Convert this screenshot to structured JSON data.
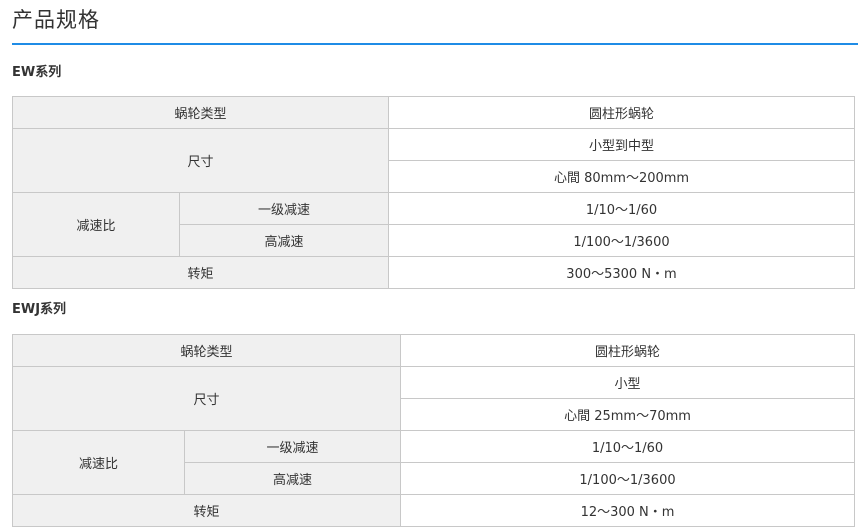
{
  "page": {
    "title": "产品规格"
  },
  "ew": {
    "heading": "EW系列",
    "type_label": "蜗轮类型",
    "type_value": "圆柱形蜗轮",
    "size_label": "尺寸",
    "size_value_1": "小型到中型",
    "size_value_2": "心間 80mm～200mm",
    "ratio_label": "减速比",
    "ratio_single_label": "一级减速",
    "ratio_single_value": "1/10～1/60",
    "ratio_high_label": "高减速",
    "ratio_high_value": "1/100～1/3600",
    "torque_label": "转矩",
    "torque_value": "300～5300 N・m"
  },
  "ewj": {
    "heading": "EWJ系列",
    "type_label": "蜗轮类型",
    "type_value": "圆柱形蜗轮",
    "size_label": "尺寸",
    "size_value_1": "小型",
    "size_value_2": "心間 25mm～70mm",
    "ratio_label": "减速比",
    "ratio_single_label": "一级减速",
    "ratio_single_value": "1/10～1/60",
    "ratio_high_label": "高减速",
    "ratio_high_value": "1/100～1/3600",
    "torque_label": "转矩",
    "torque_value": "12～300 N・m"
  }
}
